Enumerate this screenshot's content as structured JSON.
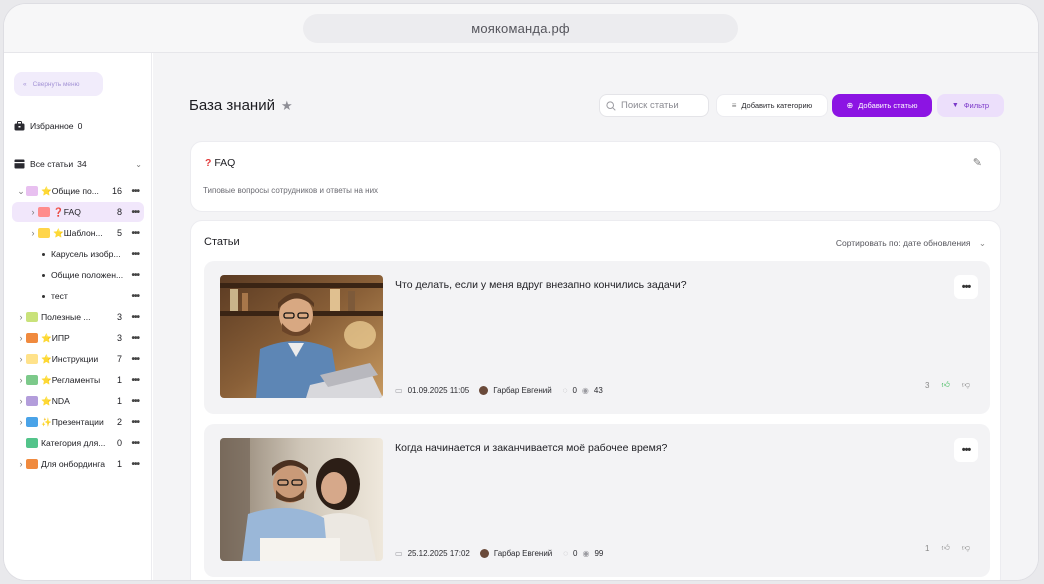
{
  "browser": {
    "url": "моякоманда.рф"
  },
  "sidebar": {
    "collapse_label": "Свернуть меню",
    "favorites": {
      "label": "Избранное",
      "count": "0"
    },
    "all_articles": {
      "label": "Все статьи",
      "count": "34"
    },
    "items": [
      {
        "label": "⭐Общие по...",
        "count": "16",
        "level": 0,
        "expanded": true,
        "icon_color": "#e8c0f0"
      },
      {
        "label": "❓FAQ",
        "count": "8",
        "level": 1,
        "active": true,
        "icon_color": "#ff8c8c"
      },
      {
        "label": "⭐Шаблон...",
        "count": "5",
        "level": 1,
        "icon_color": "#ffd54a"
      },
      {
        "label": "Карусель изобр...",
        "count": "",
        "level": 2
      },
      {
        "label": "Общие положен...",
        "count": "",
        "level": 2
      },
      {
        "label": "тест",
        "count": "",
        "level": 2
      },
      {
        "label": "Полезные ...",
        "count": "3",
        "level": 0,
        "icon_color": "#c9e27a"
      },
      {
        "label": "⭐ИПР",
        "count": "3",
        "level": 0,
        "icon_color": "#f08a3e"
      },
      {
        "label": "⭐Инструкции",
        "count": "7",
        "level": 0,
        "icon_color": "#ffe28a"
      },
      {
        "label": "⭐Регламенты",
        "count": "1",
        "level": 0,
        "icon_color": "#7cc98a"
      },
      {
        "label": "⭐NDA",
        "count": "1",
        "level": 0,
        "icon_color": "#b39ddb"
      },
      {
        "label": "✨Презентации",
        "count": "2",
        "level": 0,
        "icon_color": "#4aa3e8"
      },
      {
        "label": "Категория для...",
        "count": "0",
        "level": 0,
        "icon_color": "#53c48a",
        "no_caret": true
      },
      {
        "label": "Для онбординга",
        "count": "1",
        "level": 0,
        "icon_color": "#f08a3e"
      }
    ]
  },
  "header": {
    "title": "База знаний",
    "search_placeholder": "Поиск статьи",
    "add_category": "Добавить категорию",
    "add_article": "Добавить статью",
    "filter": "Фильтр"
  },
  "faq": {
    "title": "FAQ",
    "description": "Типовые вопросы сотрудников и ответы на них"
  },
  "articles": {
    "title": "Статьи",
    "sort": "Сортировать по: дате обновления",
    "list": [
      {
        "title": "Что делать, если у меня вдруг внезапно кончились задачи?",
        "date": "01.09.2025 11:05",
        "author": "Гарбар Евгений",
        "comments": "0",
        "views": "43",
        "likes": "3"
      },
      {
        "title": "Когда начинается и заканчивается моё рабочее время?",
        "date": "25.12.2025 17:02",
        "author": "Гарбар Евгений",
        "comments": "0",
        "views": "99",
        "likes": "1"
      }
    ]
  },
  "colors": {
    "accent": "#8c14e3",
    "accent_soft": "#ecdffb",
    "active_bg": "#f1e7fb"
  }
}
